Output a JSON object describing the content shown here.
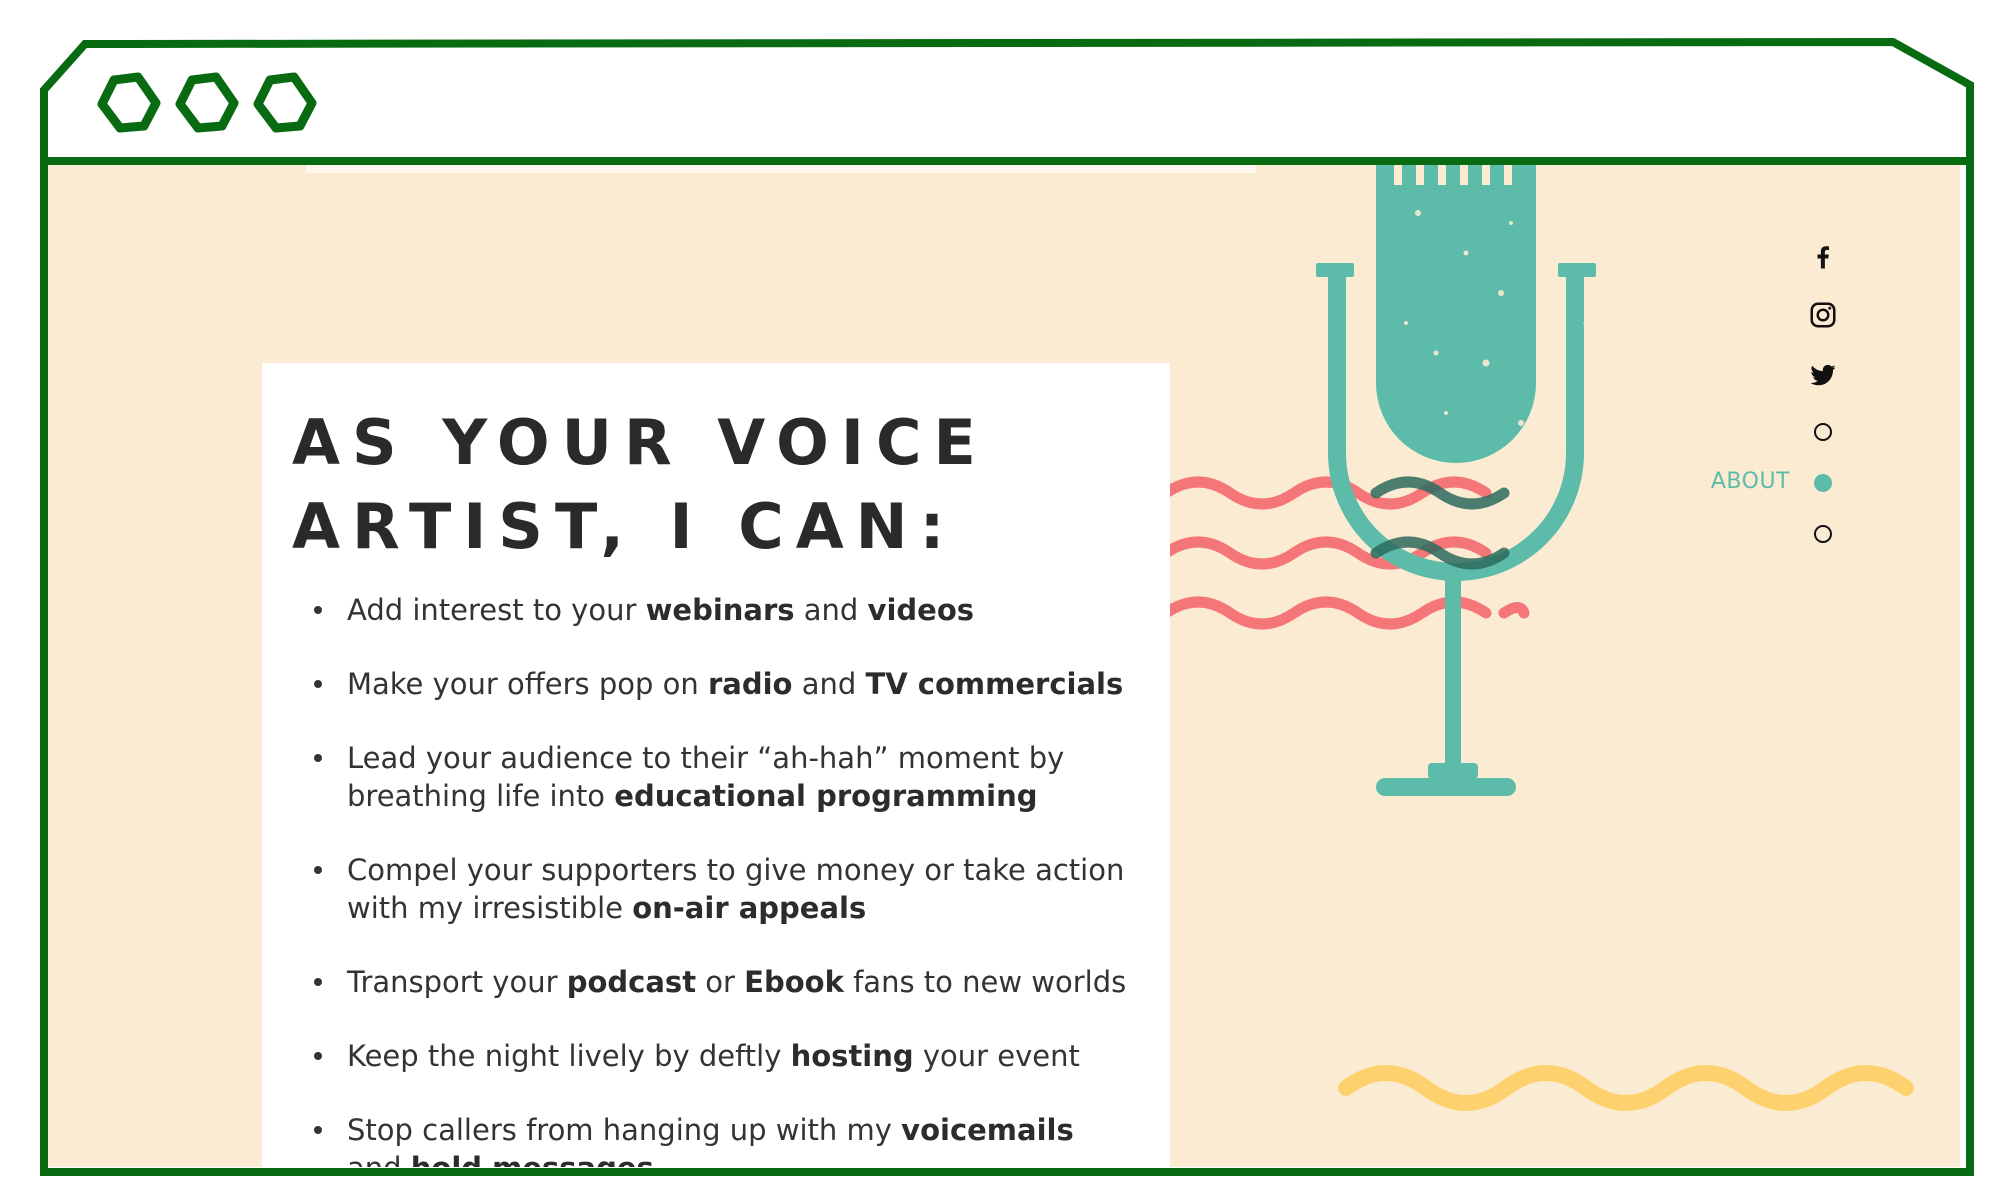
{
  "window": {
    "controls": [
      "window-control",
      "window-control",
      "window-control"
    ]
  },
  "hero": {
    "headline_line1": "AS YOUR VOICE",
    "headline_line2": "ARTIST, I CAN:"
  },
  "features": [
    {
      "parts": [
        {
          "t": "Add interest to your ",
          "b": false
        },
        {
          "t": "webinars",
          "b": true
        },
        {
          "t": " and ",
          "b": false
        },
        {
          "t": "videos",
          "b": true
        }
      ]
    },
    {
      "parts": [
        {
          "t": "Make your offers pop on ",
          "b": false
        },
        {
          "t": "radio",
          "b": true
        },
        {
          "t": " and ",
          "b": false
        },
        {
          "t": "TV commercials",
          "b": true
        }
      ]
    },
    {
      "parts": [
        {
          "t": "Lead your audience to their “ah-hah” moment by breathing life into ",
          "b": false
        },
        {
          "t": "educational programming",
          "b": true
        }
      ]
    },
    {
      "parts": [
        {
          "t": "Compel your supporters to give money or take action with my irresistible ",
          "b": false
        },
        {
          "t": "on-air appeals",
          "b": true
        }
      ]
    },
    {
      "parts": [
        {
          "t": "Transport your ",
          "b": false
        },
        {
          "t": "podcast",
          "b": true
        },
        {
          "t": " or ",
          "b": false
        },
        {
          "t": "Ebook",
          "b": true
        },
        {
          "t": " fans to new worlds",
          "b": false
        }
      ]
    },
    {
      "parts": [
        {
          "t": "Keep the night lively by deftly ",
          "b": false
        },
        {
          "t": "hosting",
          "b": true
        },
        {
          "t": " your event",
          "b": false
        }
      ]
    },
    {
      "parts": [
        {
          "t": "Stop callers from hanging up  with my ",
          "b": false
        },
        {
          "t": "voicemails",
          "b": true
        },
        {
          "t": " and ",
          "b": false
        },
        {
          "t": "hold messages",
          "b": true
        }
      ]
    }
  ],
  "social": [
    {
      "name": "facebook-icon"
    },
    {
      "name": "instagram-icon"
    },
    {
      "name": "twitter-icon"
    }
  ],
  "section_nav": {
    "items": [
      {
        "label": "",
        "active": false
      },
      {
        "label": "ABOUT",
        "active": true
      },
      {
        "label": "",
        "active": false
      }
    ]
  },
  "colors": {
    "frame": "#086b12",
    "background": "#fcebd3",
    "mic": "#5cbca9",
    "waves_red": "#f47679",
    "waves_yellow": "#fdd26e",
    "text": "#333333"
  }
}
